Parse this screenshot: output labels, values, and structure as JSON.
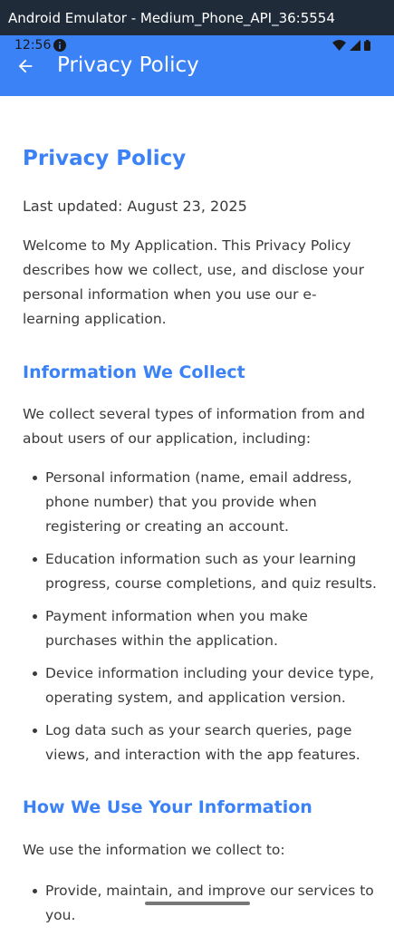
{
  "window": {
    "title": "Android Emulator - Medium_Phone_API_36:5554"
  },
  "statusbar": {
    "time": "12:56"
  },
  "appbar": {
    "title": "Privacy Policy",
    "back_icon": "arrow-left-icon"
  },
  "content": {
    "heading": "Privacy Policy",
    "last_updated": "Last updated: August 23, 2025",
    "intro": "Welcome to My Application. This Privacy Policy describes how we collect, use, and disclose your personal information when you use our e-learning application.",
    "section1": {
      "heading": "Information We Collect",
      "lead": "We collect several types of information from and about users of our application, including:",
      "items": [
        "Personal information (name, email address, phone number) that you provide when registering or creating an account.",
        "Education information such as your learning progress, course completions, and quiz results.",
        "Payment information when you make purchases within the application.",
        "Device information including your device type, operating system, and application version.",
        "Log data such as your search queries, page views, and interaction with the app features."
      ]
    },
    "section2": {
      "heading": "How We Use Your Information",
      "lead": "We use the information we collect to:",
      "items": [
        "Provide, maintain, and improve our services to you."
      ]
    }
  },
  "colors": {
    "accent": "#3b82f6",
    "titlebar": "#1f2b38",
    "text": "#3a3a3a"
  }
}
